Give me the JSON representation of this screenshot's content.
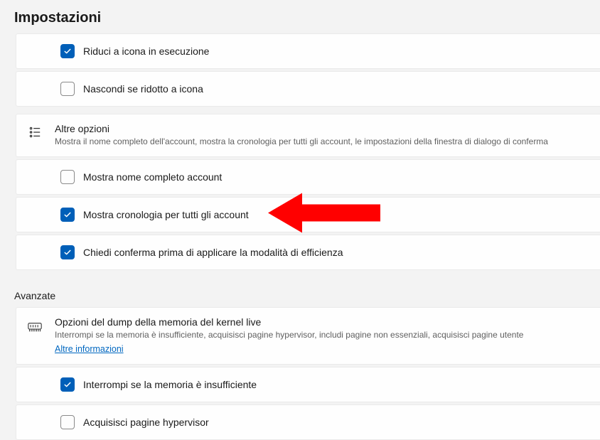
{
  "page_title": "Impostazioni",
  "rows_top": [
    {
      "key": "minimize-running",
      "label": "Riduci a icona in esecuzione",
      "checked": true
    },
    {
      "key": "hide-minimized",
      "label": "Nascondi se ridotto a icona",
      "checked": false
    }
  ],
  "other_options": {
    "title": "Altre opzioni",
    "subtitle": "Mostra il nome completo dell'account, mostra la cronologia per tutti gli account, le impostazioni della finestra di dialogo di conferma"
  },
  "rows_other": [
    {
      "key": "show-full-account",
      "label": "Mostra nome completo account",
      "checked": false
    },
    {
      "key": "show-history-all",
      "label": "Mostra cronologia per tutti gli account",
      "checked": true,
      "arrow": true
    },
    {
      "key": "confirm-efficiency",
      "label": "Chiedi conferma prima di applicare la modalità di efficienza",
      "checked": true
    }
  ],
  "advanced_label": "Avanzate",
  "kernel_dump": {
    "title": "Opzioni del dump della memoria del kernel live",
    "subtitle": "Interrompi se la memoria è insufficiente, acquisisci pagine hypervisor, includi pagine non essenziali, acquisisci pagine utente",
    "link": "Altre informazioni"
  },
  "rows_kernel": [
    {
      "key": "abort-low-memory",
      "label": "Interrompi se la memoria è insufficiente",
      "checked": true
    },
    {
      "key": "capture-hypervisor",
      "label": "Acquisisci pagine hypervisor",
      "checked": false
    }
  ]
}
